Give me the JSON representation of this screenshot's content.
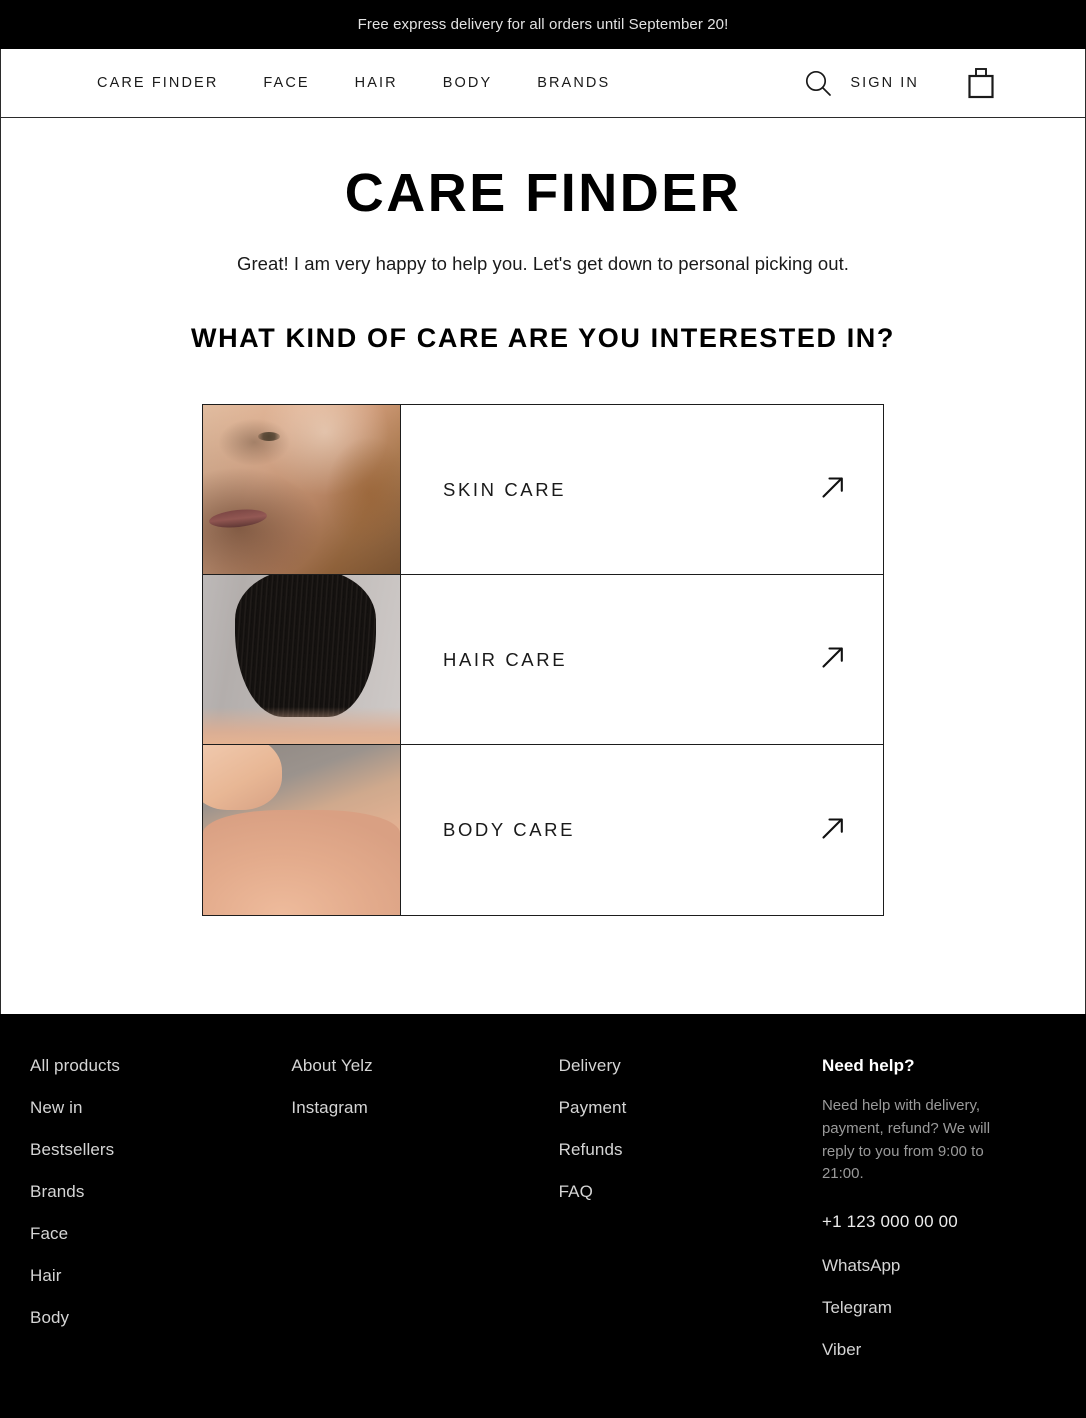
{
  "promo": {
    "text": "Free express delivery for all orders until September 20!"
  },
  "header": {
    "nav": [
      {
        "label": "CARE FINDER"
      },
      {
        "label": "FACE"
      },
      {
        "label": "HAIR"
      },
      {
        "label": "BODY"
      },
      {
        "label": "BRANDS"
      }
    ],
    "search_icon": "search-icon",
    "signin_label": "SIGN IN",
    "bag_icon": "shopping-bag-icon"
  },
  "main": {
    "title": "CARE FINDER",
    "subtitle": "Great! I am very happy to help you. Let's get down to personal picking out.",
    "question": "WHAT KIND OF CARE ARE YOU INTERESTED IN?",
    "options": [
      {
        "label": "SKIN CARE",
        "arrow_icon": "arrow-up-right-icon",
        "image": "close-up-face-photo"
      },
      {
        "label": "HAIR CARE",
        "arrow_icon": "arrow-up-right-icon",
        "image": "dark-bob-hair-photo"
      },
      {
        "label": "BODY CARE",
        "arrow_icon": "arrow-up-right-icon",
        "image": "bare-shoulder-photo"
      }
    ]
  },
  "footer": {
    "col1": [
      {
        "label": "All products"
      },
      {
        "label": "New in"
      },
      {
        "label": "Bestsellers"
      },
      {
        "label": "Brands"
      },
      {
        "label": "Face"
      },
      {
        "label": "Hair"
      },
      {
        "label": "Body"
      }
    ],
    "col2": [
      {
        "label": "About Yelz"
      },
      {
        "label": "Instagram"
      }
    ],
    "col3": [
      {
        "label": "Delivery"
      },
      {
        "label": "Payment"
      },
      {
        "label": "Refunds"
      },
      {
        "label": "FAQ"
      }
    ],
    "help": {
      "heading": "Need help?",
      "note": "Need help with delivery, payment, refund? We will reply to you from 9:00 to 21:00.",
      "phone": "+1 123 000 00 00",
      "messengers": [
        {
          "label": "WhatsApp"
        },
        {
          "label": "Telegram"
        },
        {
          "label": "Viber"
        }
      ]
    }
  },
  "colors": {
    "background": "#ffffff",
    "ink": "#000000",
    "border": "#1d1d1d",
    "promo_text": "#e2e2e2",
    "footer_link": "#d5d5d5",
    "footer_muted": "#9a9a9a"
  }
}
